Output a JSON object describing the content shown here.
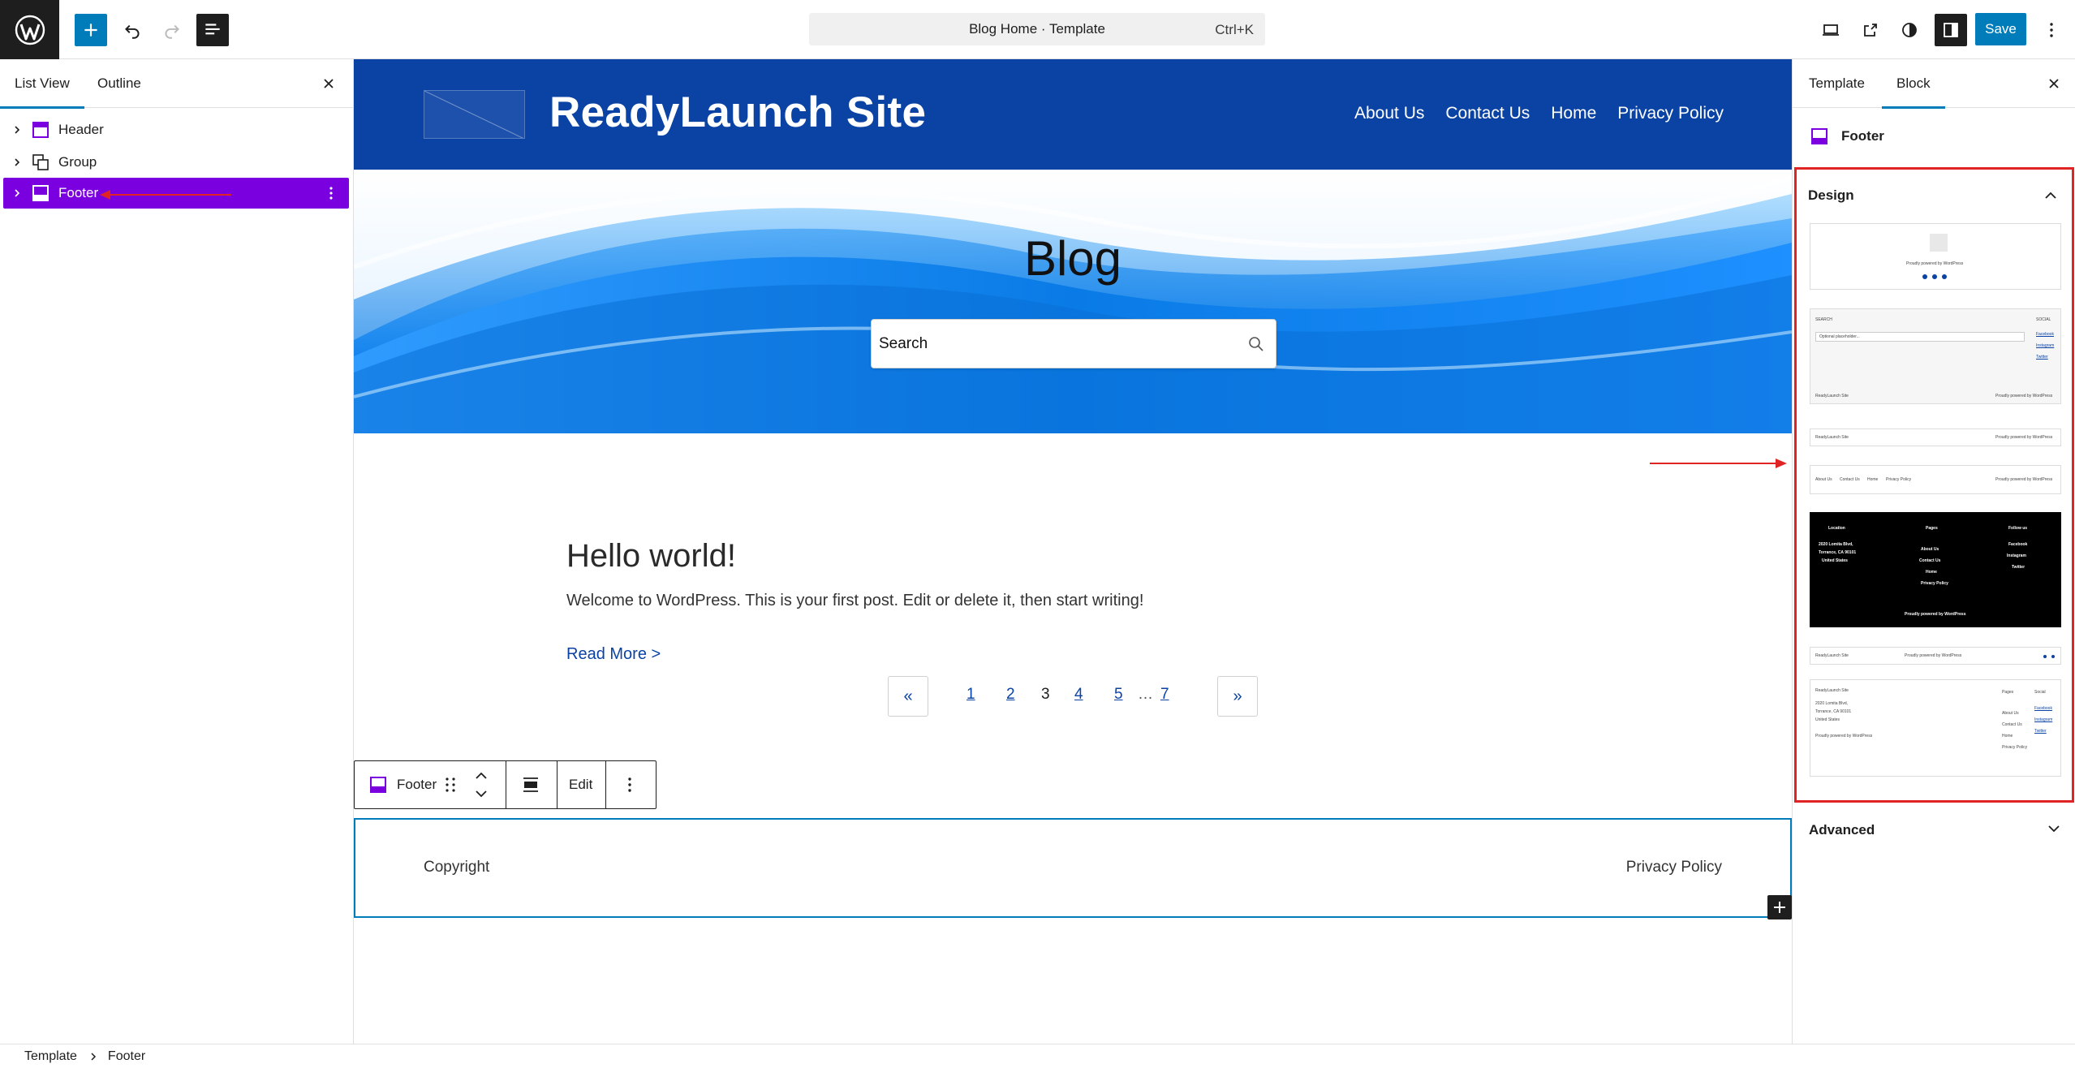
{
  "topbar": {
    "command_label": "Blog Home · Template",
    "command_shortcut": "Ctrl+K",
    "save_label": "Save"
  },
  "left_panel": {
    "tabs": [
      {
        "label": "List View",
        "active": true
      },
      {
        "label": "Outline",
        "active": false
      }
    ],
    "items": [
      {
        "label": "Header",
        "icon": "layout-icon"
      },
      {
        "label": "Group",
        "icon": "group-icon"
      },
      {
        "label": "Footer",
        "icon": "footer-icon",
        "selected": true
      }
    ]
  },
  "canvas": {
    "site_title": "ReadyLaunch Site",
    "nav": [
      "About Us",
      "Contact Us",
      "Home",
      "Privacy Policy"
    ],
    "hero_title": "Blog",
    "search_placeholder": "Search",
    "post": {
      "title": "Hello world!",
      "excerpt": "Welcome to WordPress. This is your first post. Edit or delete it, then start writing!",
      "read_more": "Read More >"
    },
    "pagination": {
      "prev": "«",
      "next": "»",
      "pages": [
        "1",
        "2",
        "3",
        "4",
        "5",
        "7"
      ],
      "current": "3",
      "ellipsis": "…"
    },
    "block_toolbar": {
      "block_label": "Footer",
      "edit_label": "Edit"
    },
    "footer": {
      "left": "Copyright",
      "right": "Privacy Policy"
    }
  },
  "right_panel": {
    "tabs": [
      {
        "label": "Template",
        "active": false
      },
      {
        "label": "Block",
        "active": true
      }
    ],
    "block_name": "Footer",
    "design_label": "Design",
    "advanced_label": "Advanced",
    "patterns": {
      "p1": {
        "text": "Proudly powered by WordPress"
      },
      "p2": {
        "search": "SEARCH",
        "social": "SOCIAL",
        "placeholder": "Optional placeholder...",
        "links": [
          "Facebook",
          "Instagram",
          "Twitter"
        ],
        "site": "ReadyLaunch Site",
        "powered": "Proudly powered by WordPress"
      },
      "p3": {
        "site": "ReadyLaunch Site",
        "powered": "Proudly powered by WordPress"
      },
      "p4": {
        "links": [
          "About Us",
          "Contact Us",
          "Home",
          "Privacy Policy"
        ],
        "powered": "Proudly powered by WordPress"
      },
      "p5": {
        "location": "Location",
        "pages": "Pages",
        "follow": "Follow us",
        "address": [
          "2020 Lomita Blvd,",
          "Torrance, CA 90101",
          "United States"
        ],
        "page_links": [
          "About Us",
          "Contact Us",
          "Home",
          "Privacy Policy"
        ],
        "social": [
          "Facebook",
          "Instagram",
          "Twitter"
        ],
        "powered": "Proudly powered by WordPress"
      },
      "p6": {
        "site": "ReadyLaunch Site",
        "powered": "Proudly powered by WordPress"
      },
      "p7": {
        "site": "ReadyLaunch Site",
        "address": [
          "2020 Lomita Blvd,",
          "Torrance, CA 90101",
          "United States"
        ],
        "powered": "Proudly powered by WordPress",
        "pages": "Pages",
        "social": "Social",
        "page_links": [
          "About Us",
          "Contact Us",
          "Home",
          "Privacy Policy"
        ],
        "social_links": [
          "Facebook",
          "Instagram",
          "Twitter"
        ]
      }
    }
  },
  "breadcrumb": [
    "Template",
    "Footer"
  ],
  "colors": {
    "admin_accent": "#007cba",
    "selection": "#7a00df",
    "site_header": "#0a43a4",
    "annotation": "#e02424"
  }
}
